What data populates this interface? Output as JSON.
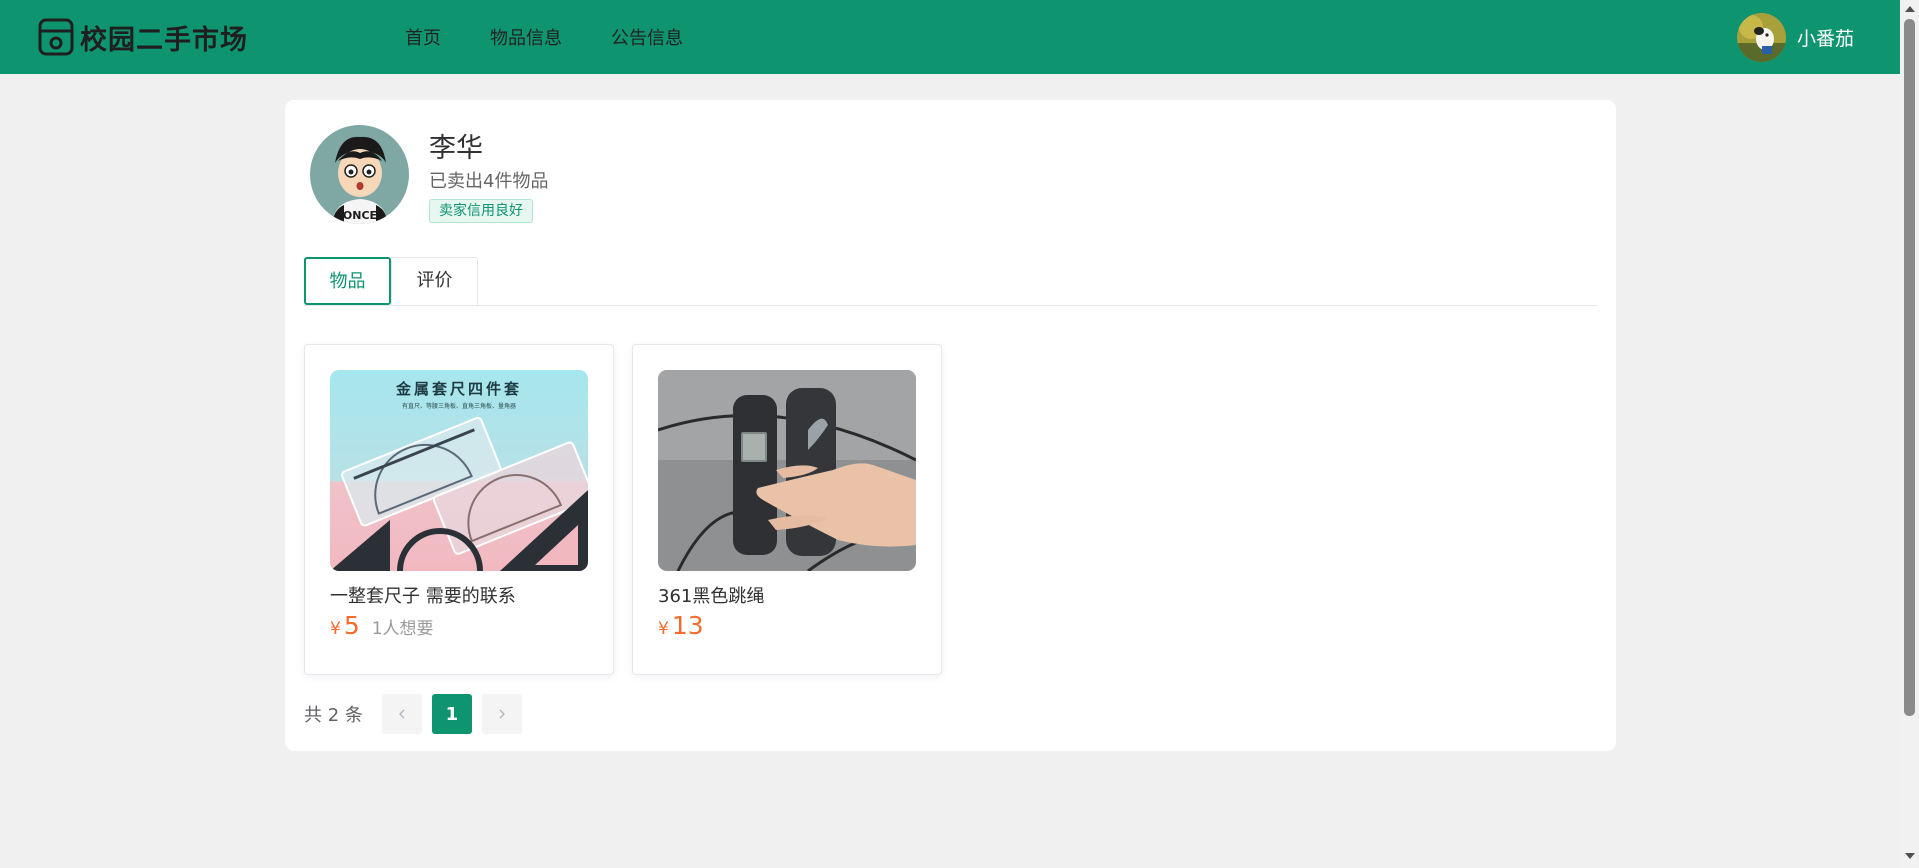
{
  "header": {
    "app_name": "校园二手市场",
    "nav": [
      {
        "label": "首页"
      },
      {
        "label": "物品信息"
      },
      {
        "label": "公告信息"
      }
    ],
    "user_name": "小番茄",
    "brand_color": "#0f9470"
  },
  "profile": {
    "name": "李华",
    "sold_text": "已卖出4件物品",
    "credit_tag": "卖家信用良好"
  },
  "tabs": [
    {
      "label": "物品",
      "active": true
    },
    {
      "label": "评价",
      "active": false
    }
  ],
  "goods": [
    {
      "title": "一整套尺子 需要的联系",
      "currency": "¥",
      "price": "5",
      "want": "1人想要",
      "image_text_line1": "金属套尺四件套",
      "image_text_line2": "有直尺、等腰三角板、直角三角板、量角器"
    },
    {
      "title": "361黑色跳绳",
      "currency": "¥",
      "price": "13",
      "want": ""
    }
  ],
  "pagination": {
    "total_text": "共 2 条",
    "prev_icon": "chevron-left-icon",
    "current_page": "1",
    "next_icon": "chevron-right-icon"
  },
  "colors": {
    "price": "#f56c2d",
    "background": "#f0f0f0"
  }
}
